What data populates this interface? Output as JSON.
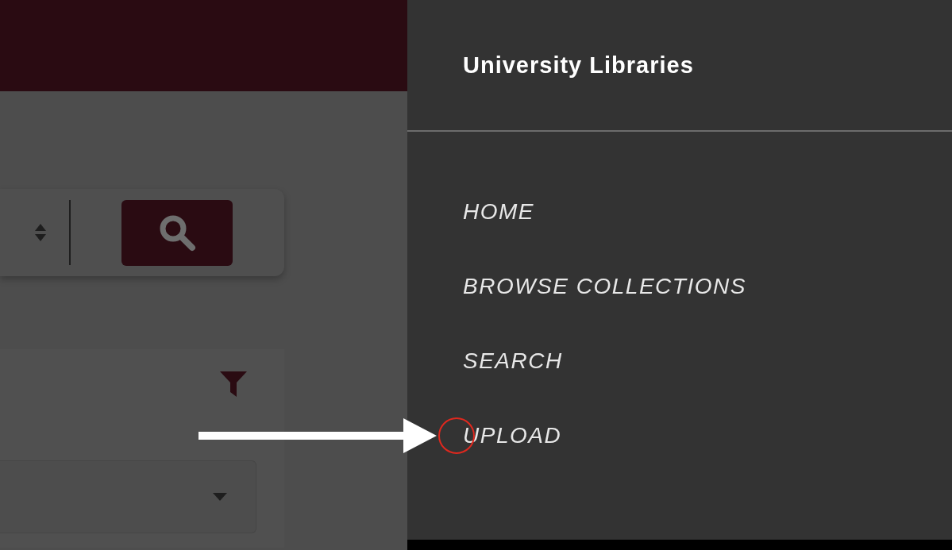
{
  "menu": {
    "title": "University Libraries",
    "items": [
      {
        "label": "HOME",
        "highlighted": false
      },
      {
        "label": "BROWSE COLLECTIONS",
        "highlighted": false
      },
      {
        "label": "SEARCH",
        "highlighted": false
      },
      {
        "label": "UPLOAD",
        "highlighted": true
      }
    ]
  }
}
